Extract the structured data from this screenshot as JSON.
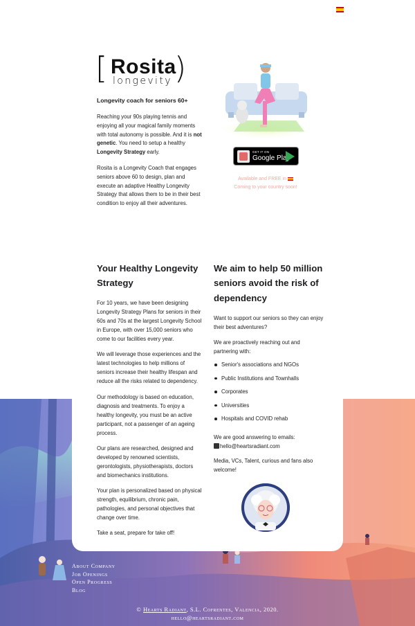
{
  "header": {
    "language_flag": "spain-flag-icon"
  },
  "logo": {
    "name": "Rosita",
    "sub": "longevity",
    "left_bracket": "[",
    "right_bracket": ")"
  },
  "hero": {
    "tagline": "Longevity coach for seniors 60+",
    "para1_a": "Reaching your 90s playing tennis and enjoying all your magical family moments with total autonomy is possible. And it is ",
    "para1_bold": "not genetic",
    "para1_b": ". You need to setup a healthy ",
    "para1_bold2": "Longevity Strategy",
    "para1_c": " early.",
    "para2": "Rosita is a Longevity Coach that engages seniors above 60 to design, plan and execute an adaptive Healthy Longevity Strategy that allows them to be in their best condition to enjoy all their adventures.",
    "play_small": "GET IT ON",
    "play_big": "Google Play",
    "available": "Available and FREE in",
    "coming": "Coming to your country soon!"
  },
  "strategy": {
    "title": "Your Healthy Longevity Strategy",
    "p1": "For 10 years, we have been designing Longevity Strategy Plans for seniors in their 60s and 70s at the largest Longevity School in Europe, with over 15,000 seniors who come to our facilities every year.",
    "p2": "We will leverage those experiences and the latest technologies to help millions of seniors increase their healthy lifespan and reduce all the risks related to dependency.",
    "p3": "Our methodology is based on education, diagnosis and treatments. To enjoy a healthy longevity, you must be an active participant, not a passenger of an ageing process.",
    "p4": "Our plans are researched, designed and developed by renowned scientists, gerontologists, physiotherapists, doctors and biomechanics institutions.",
    "p5": "Your plan is personalized based on physical strength, equilibrium, chronic pain, pathologies, and personal objectives that change over time.",
    "p6": "Take a seat, prepare for take off!"
  },
  "aim": {
    "title": "We aim to help 50 million seniors avoid the risk of dependency",
    "p1": "Want to support our seniors so they can enjoy their best adventures?",
    "p2": "We are proactively reaching out and partnering with:",
    "partners": [
      "Senior's associations and NGOs",
      "Public Institutions and Townhalls",
      "Corporates",
      "Universities",
      "Hospitals and COVID rehab"
    ],
    "email_intro": "We are good answering to emails:",
    "email": "hello@heartsradiant.com",
    "welcome": "Media, VCs, Talent, curious and fans also welcome!"
  },
  "footer": {
    "links": [
      "About Company",
      "Job Openings",
      "Open Progress",
      "Blog"
    ],
    "copy_prefix": "© ",
    "company": "Hearts Radiant",
    "copy_suffix": ", S.L. Cofrentes, Valencia, 2020.",
    "email": "hello@heartsradiant.com"
  },
  "colors": {
    "available_text": "#f2a9a0",
    "card": "#ffffff",
    "sky_left": "#7b8fd6",
    "sky_right": "#f7a98a"
  }
}
